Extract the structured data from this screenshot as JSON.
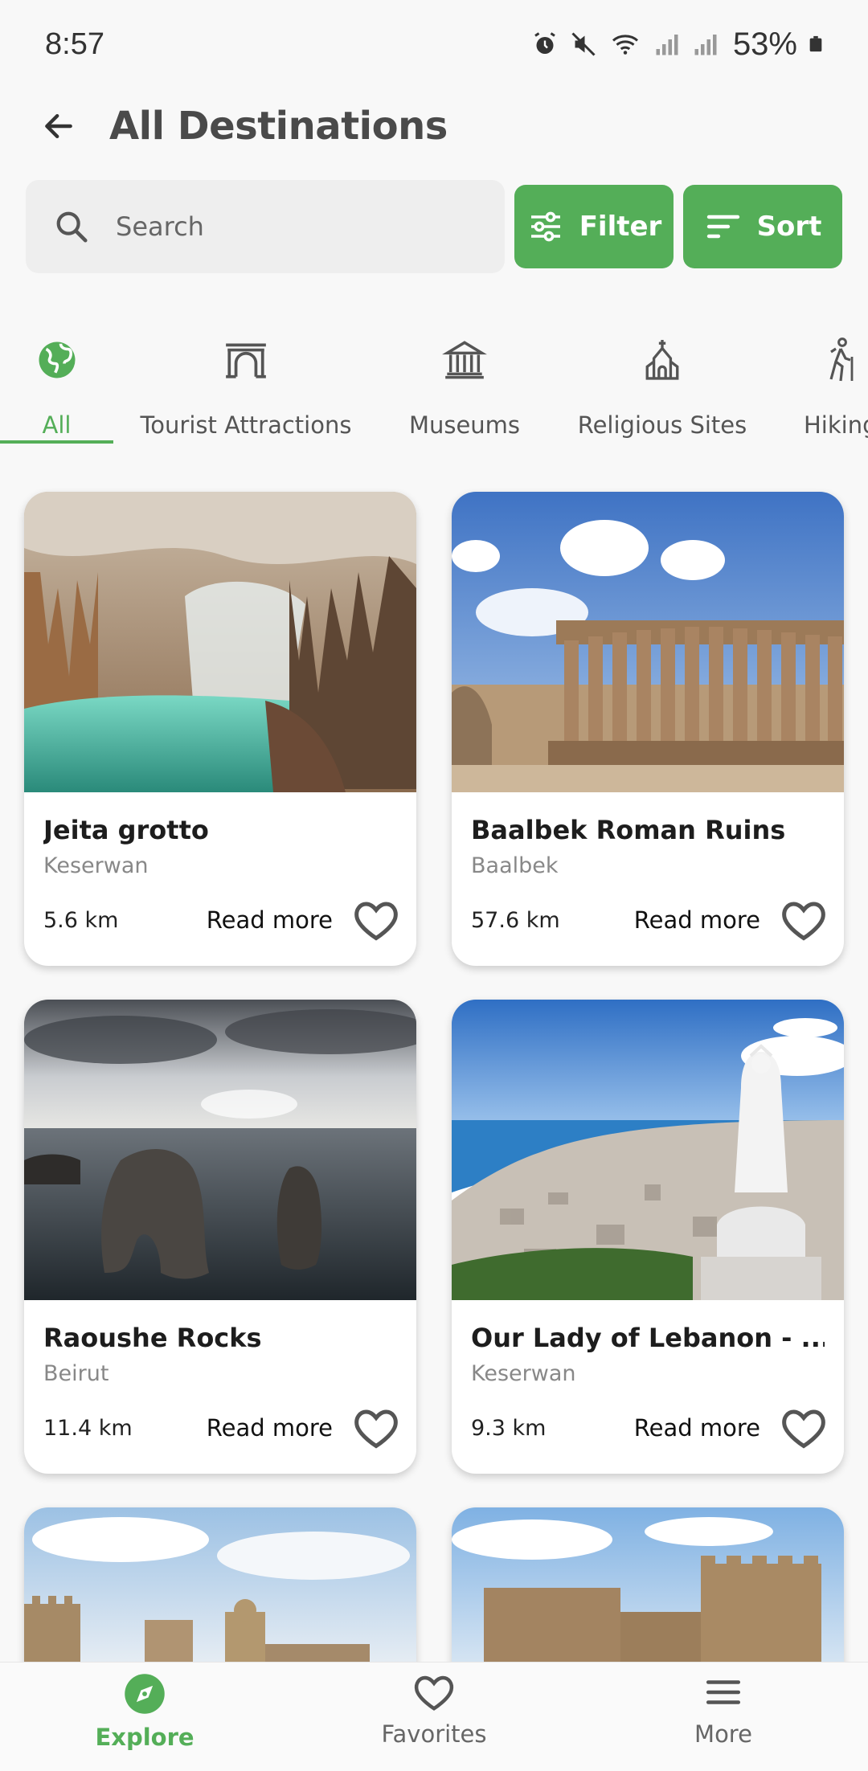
{
  "status_bar": {
    "time": "8:57",
    "battery": "53%"
  },
  "header": {
    "title": "All Destinations"
  },
  "search": {
    "placeholder": "Search",
    "value": ""
  },
  "actions": {
    "filter_label": "Filter",
    "sort_label": "Sort"
  },
  "categories": [
    {
      "label": "All",
      "icon": "globe-icon",
      "active": true
    },
    {
      "label": "Tourist Attractions",
      "icon": "arch-icon",
      "active": false
    },
    {
      "label": "Museums",
      "icon": "museum-icon",
      "active": false
    },
    {
      "label": "Religious Sites",
      "icon": "church-icon",
      "active": false
    },
    {
      "label": "Hiking",
      "icon": "hiking-icon",
      "active": false
    }
  ],
  "cards": [
    {
      "title": "Jeita grotto",
      "location": "Keserwan",
      "distance": "5.6 km",
      "read_more": "Read more",
      "image": "cave-grotto"
    },
    {
      "title": "Baalbek Roman Ruins",
      "location": "Baalbek",
      "distance": "57.6 km",
      "read_more": "Read more",
      "image": "roman-temple"
    },
    {
      "title": "Raoushe Rocks",
      "location": "Beirut",
      "distance": "11.4 km",
      "read_more": "Read more",
      "image": "sea-rocks"
    },
    {
      "title": "Our Lady of Lebanon - ...",
      "location": "Keserwan",
      "distance": "9.3 km",
      "read_more": "Read more",
      "image": "statue-coast"
    }
  ],
  "bottom_nav": [
    {
      "label": "Explore",
      "icon": "compass-icon",
      "active": true
    },
    {
      "label": "Favorites",
      "icon": "heart-icon",
      "active": false
    },
    {
      "label": "More",
      "icon": "menu-icon",
      "active": false
    }
  ],
  "colors": {
    "accent": "#54ae58",
    "background": "#f8f8f8",
    "title": "#4a4a4a"
  }
}
